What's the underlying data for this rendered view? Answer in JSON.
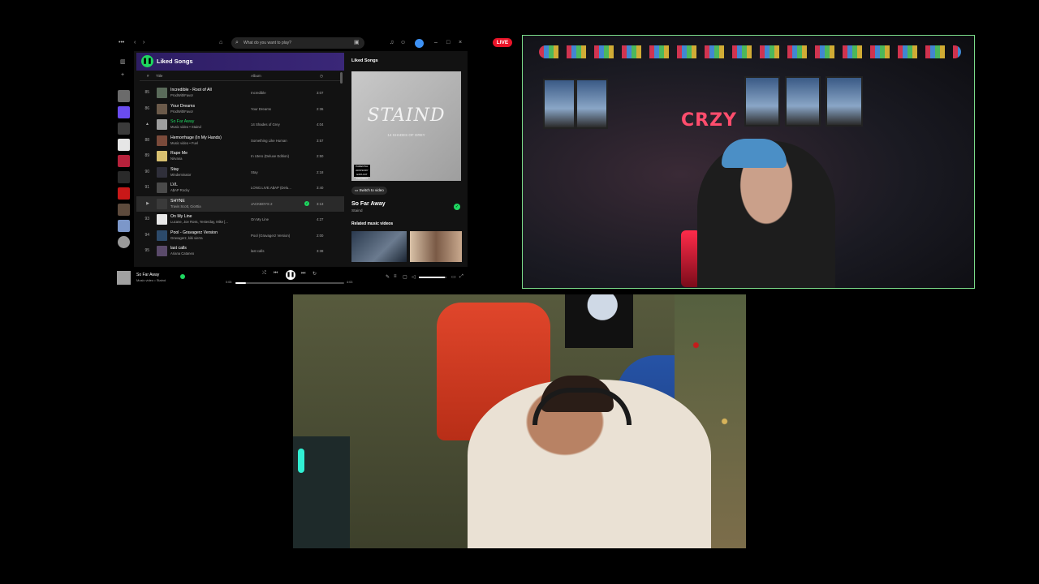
{
  "spotify": {
    "search_placeholder": "What do you want to play?",
    "playlist_title": "Liked Songs",
    "columns": {
      "number": "#",
      "title": "Title",
      "album": "Album"
    },
    "rows": [
      {
        "num": "85",
        "title": "Incredible - Root of All",
        "artist": "ProdWithFavor",
        "album": "Incredible",
        "duration": "3:07",
        "active": false,
        "playing": false,
        "liked": false
      },
      {
        "num": "86",
        "title": "Your Dreams",
        "artist": "ProdWithFavor",
        "album": "Your Dreams",
        "duration": "2:36",
        "active": false,
        "playing": false,
        "liked": false
      },
      {
        "num": "▲",
        "title": "So Far Away",
        "artist": "Music video • Staind",
        "album": "14 Shades of Grey",
        "duration": "4:04",
        "active": false,
        "playing": true,
        "liked": false
      },
      {
        "num": "88",
        "title": "Hemorrhage (In My Hands)",
        "artist": "Music video • Fuel",
        "album": "Something Like Human",
        "duration": "3:57",
        "active": false,
        "playing": false,
        "liked": false
      },
      {
        "num": "89",
        "title": "Rape Me",
        "artist": "Nirvana",
        "album": "In Utero (Deluxe Edition)",
        "duration": "2:50",
        "active": false,
        "playing": false,
        "liked": false
      },
      {
        "num": "90",
        "title": "Stay",
        "artist": "Mindeminator",
        "album": "Stay",
        "duration": "2:18",
        "active": false,
        "playing": false,
        "liked": false
      },
      {
        "num": "91",
        "title": "LVL",
        "artist": "A$AP Rocky",
        "album": "LONG.LIVE.A$AP (Delu...",
        "duration": "3:40",
        "active": false,
        "playing": false,
        "liked": false
      },
      {
        "num": "▶",
        "title": "SHYNE",
        "artist": "Travis Scott, Gio!ttia",
        "album": "JACKBOYS 2",
        "duration": "3:13",
        "active": true,
        "playing": false,
        "liked": true
      },
      {
        "num": "93",
        "title": "On My Line",
        "artist": "Lucane, Joe Ross, Yesterday, Mike [...",
        "album": "On My Line",
        "duration": "4:27",
        "active": false,
        "playing": false,
        "liked": false
      },
      {
        "num": "94",
        "title": "Pool - Gravagerz Version",
        "artist": "Gravagerz, kiki vierra",
        "album": "Pool (Gravagerz Version)",
        "duration": "2:00",
        "active": false,
        "playing": false,
        "liked": false
      },
      {
        "num": "95",
        "title": "last calls",
        "artist": "Ariana Cataneo",
        "album": "last calls",
        "duration": "3:38",
        "active": false,
        "playing": false,
        "liked": false
      }
    ],
    "right_panel": {
      "label": "Liked Songs",
      "album_art_band": "STAIND",
      "album_art_subtitle": "14 SHADES OF GREY",
      "advisory": "PARENTAL ADVISORY EXPLICIT CONTENT",
      "switch_to_video": "Switch to video",
      "song": "So Far Away",
      "artist": "Staind",
      "related_label": "Related music videos"
    },
    "now_playing": {
      "title": "So Far Away",
      "subtitle": "Music video • Staind",
      "time_elapsed": "0:05",
      "time_total": "4:03",
      "progress": 0.1,
      "volume": 0.95
    }
  },
  "stream": {
    "live_label": "LIVE",
    "neon_sign": "CRZY"
  },
  "colors": {
    "spotify_green": "#1ed760",
    "live_red": "#e91429",
    "cam_border": "#7bdc8a"
  }
}
